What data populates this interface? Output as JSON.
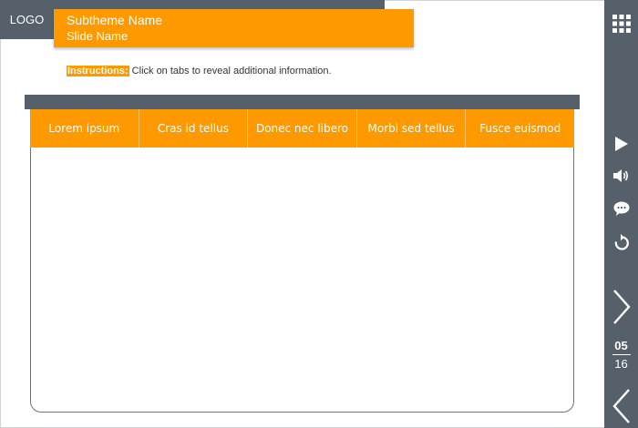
{
  "header": {
    "logo": "LOGO",
    "subtheme": "Subtheme Name",
    "slide_name": "Slide Name"
  },
  "instructions": {
    "label": "Instructions:",
    "text": " Click on tabs to reveal additional information."
  },
  "tabs": [
    {
      "label": "Lorem ipsum"
    },
    {
      "label": "Cras id tellus"
    },
    {
      "label": "Donec nec libero"
    },
    {
      "label": "Morbi sed tellus"
    },
    {
      "label": "Fusce euismod"
    }
  ],
  "sidebar": {
    "icons": [
      "grid-icon",
      "play-icon",
      "volume-icon",
      "comment-icon",
      "replay-icon",
      "next-icon",
      "prev-icon"
    ],
    "page_current": "05",
    "page_total": "16"
  },
  "colors": {
    "accent": "#ff9900",
    "sidebar": "#56606b"
  }
}
